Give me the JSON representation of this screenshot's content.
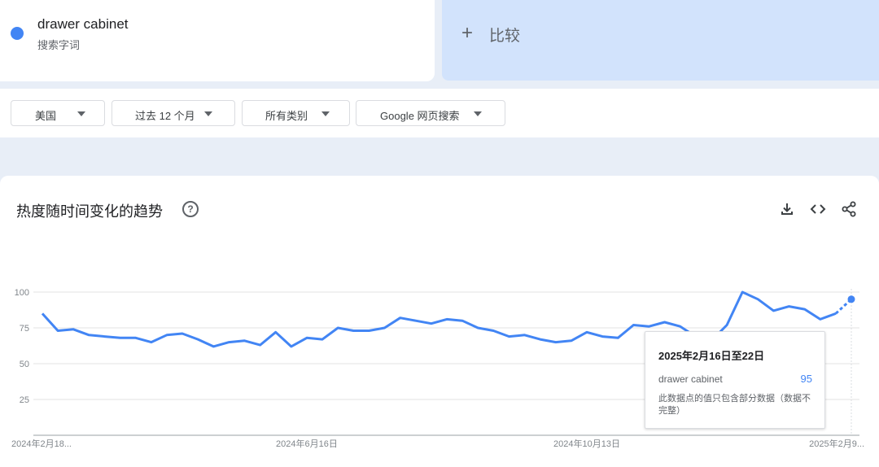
{
  "term": {
    "name": "drawer cabinet",
    "type": "搜索字词",
    "color": "#4285f4"
  },
  "compare": {
    "label": "比较",
    "icon": "plus-icon"
  },
  "filters": [
    {
      "label": "美国"
    },
    {
      "label": "过去 12 个月"
    },
    {
      "label": "所有类别"
    },
    {
      "label": "Google 网页搜索"
    }
  ],
  "chart_header": {
    "title": "热度随时间变化的趋势",
    "help_icon": "?",
    "icons": [
      "download-icon",
      "embed-code-icon",
      "share-icon"
    ]
  },
  "chart_data": {
    "type": "line",
    "title": "热度随时间变化的趋势",
    "xlabel": "",
    "ylabel": "",
    "ylim": [
      0,
      100
    ],
    "yticks": [
      25,
      50,
      75,
      100
    ],
    "grid": true,
    "x_tick_labels": [
      "2024年2月18...",
      "2024年6月16日",
      "2024年10月13日",
      "2025年2月9..."
    ],
    "series": [
      {
        "name": "drawer cabinet",
        "color": "#4285f4",
        "values": [
          85,
          73,
          74,
          70,
          69,
          68,
          68,
          65,
          70,
          71,
          67,
          62,
          65,
          66,
          63,
          72,
          62,
          68,
          67,
          75,
          73,
          73,
          75,
          82,
          80,
          78,
          81,
          80,
          75,
          73,
          69,
          70,
          67,
          65,
          66,
          72,
          69,
          68,
          77,
          76,
          79,
          76,
          69,
          66,
          77,
          100,
          95,
          87,
          90,
          88,
          81,
          85,
          95
        ]
      }
    ],
    "highlight_index": 52,
    "highlight_partial": true
  },
  "tooltip": {
    "date": "2025年2月16日至22日",
    "term": "drawer cabinet",
    "value": "95",
    "note": "此数据点的值只包含部分数据（数据不完整）"
  }
}
